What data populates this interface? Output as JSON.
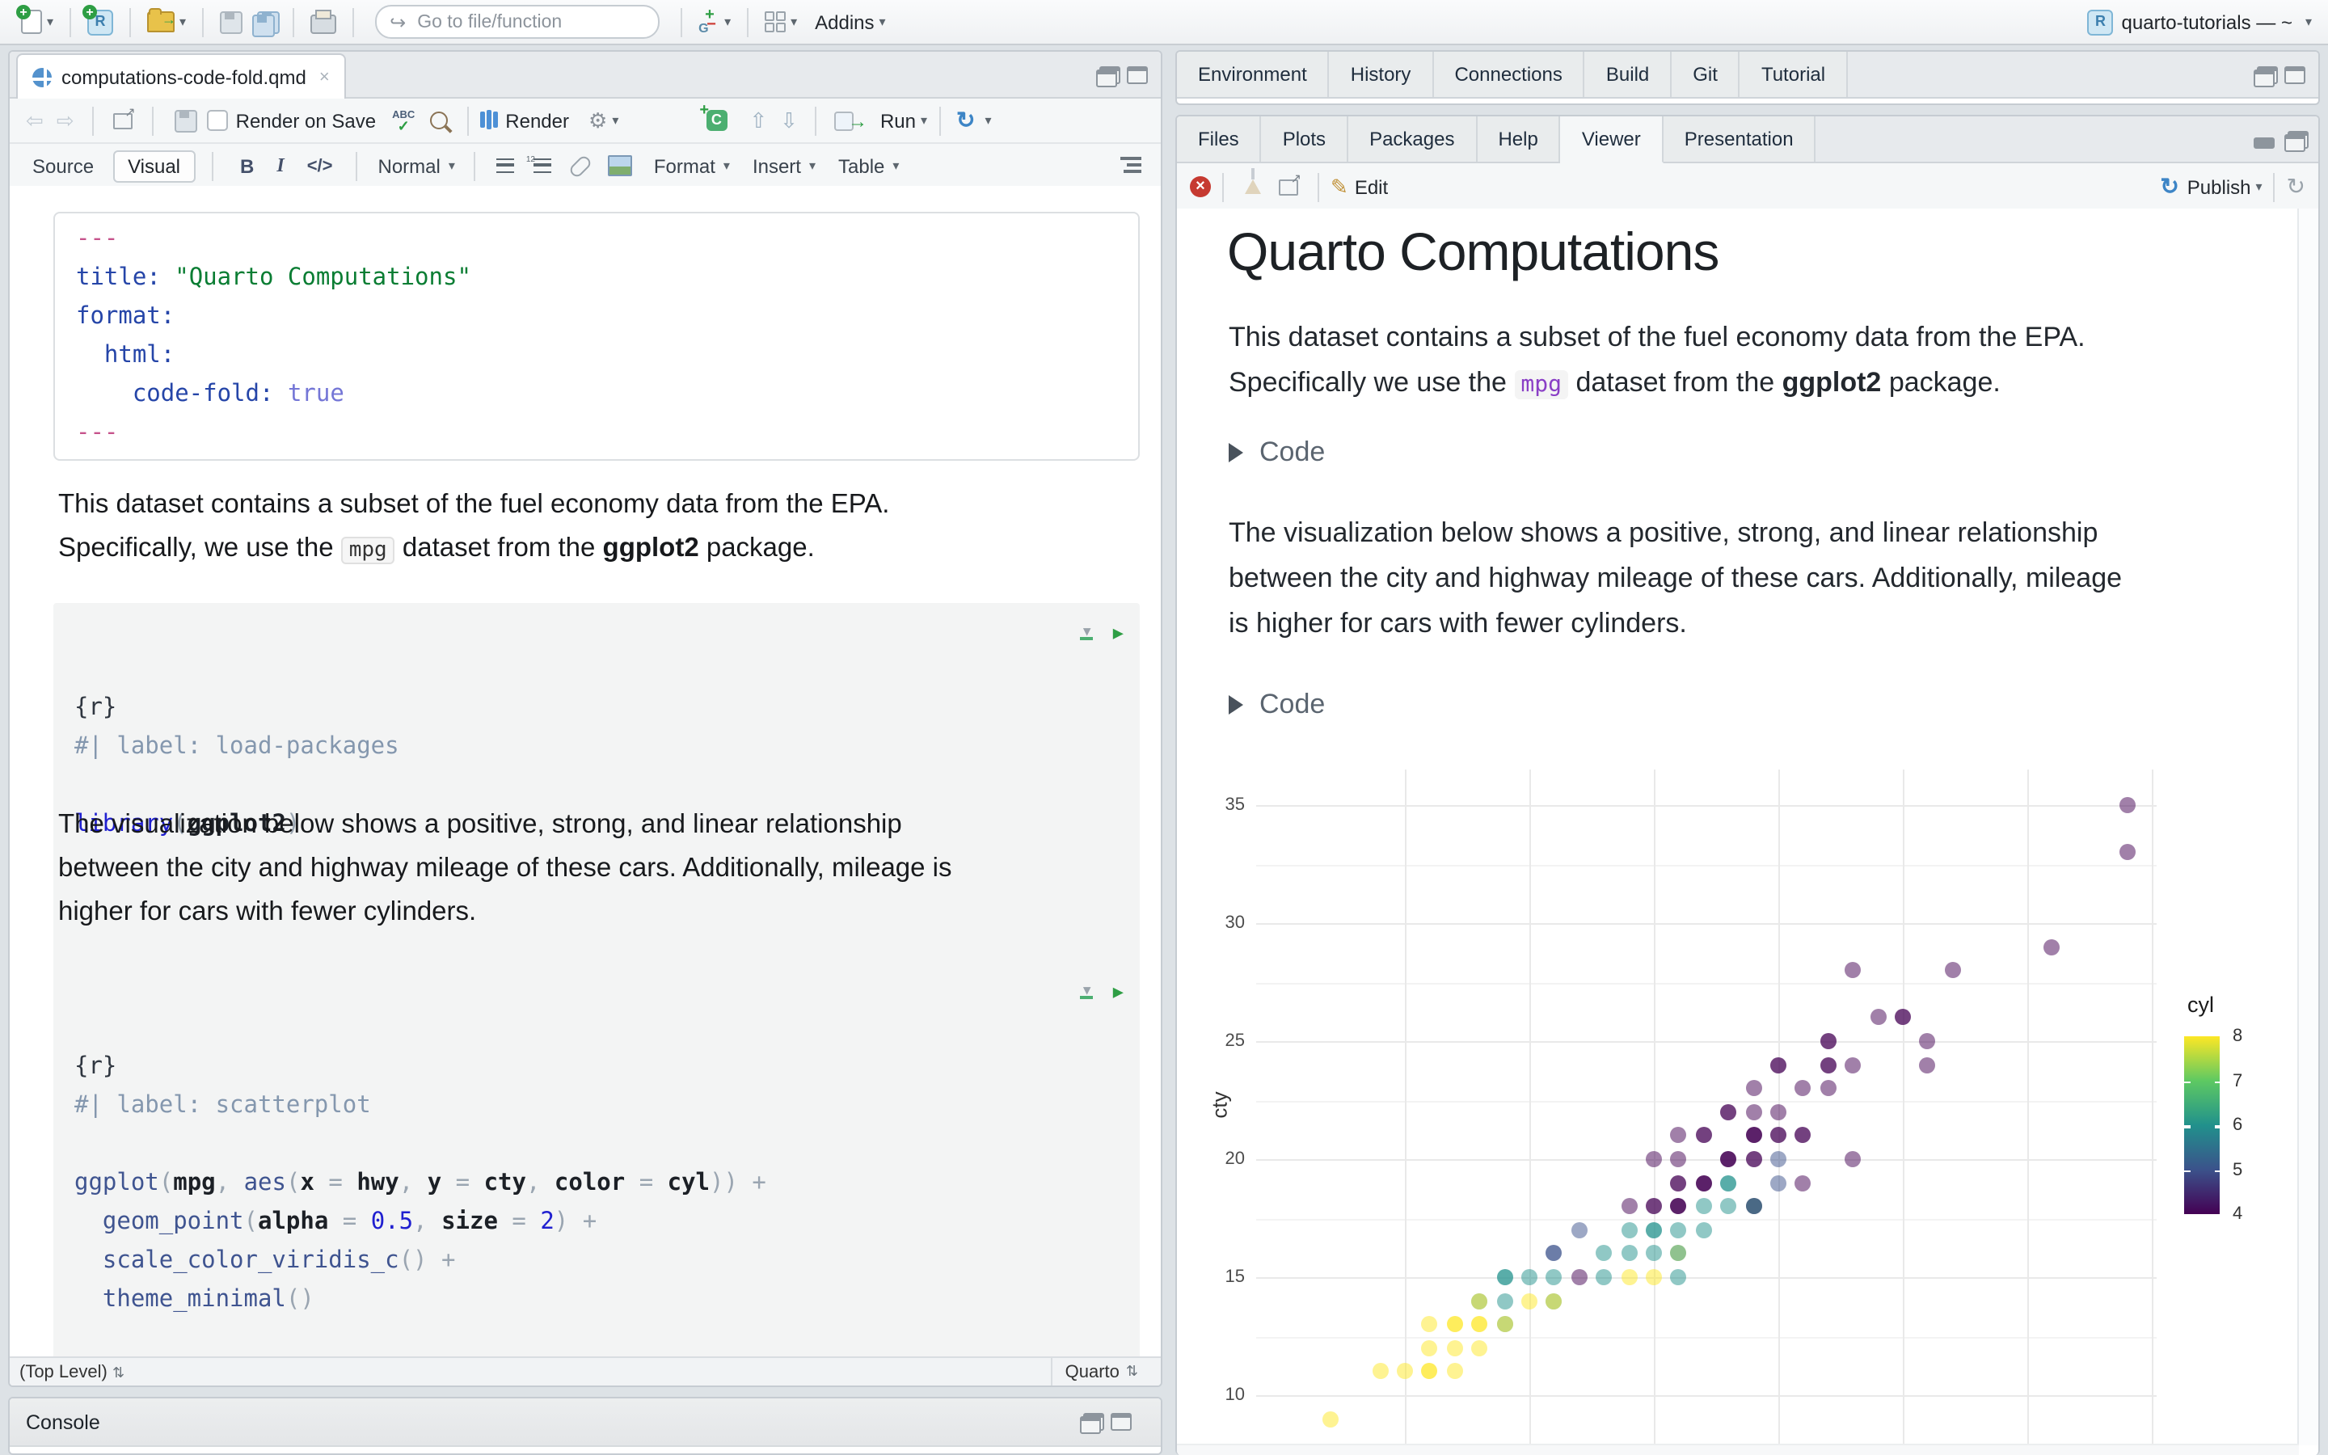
{
  "window": {
    "project": "quarto-tutorials — ~"
  },
  "main_toolbar": {
    "goto_placeholder": "Go to file/function",
    "addins": "Addins"
  },
  "editor": {
    "tab_title": "computations-code-fold.qmd",
    "toolbar": {
      "render_on_save": "Render on Save",
      "render": "Render",
      "run": "Run"
    },
    "format_bar": {
      "source": "Source",
      "visual": "Visual",
      "paragraph_style": "Normal",
      "format": "Format",
      "insert": "Insert",
      "table": "Table"
    },
    "yaml_lines": [
      [
        [
          "---",
          "pink"
        ]
      ],
      [
        [
          "title",
          "key"
        ],
        [
          ": ",
          "key"
        ],
        [
          "\"Quarto Computations\"",
          "str"
        ]
      ],
      [
        [
          "format",
          "key"
        ],
        [
          ":",
          "key"
        ]
      ],
      [
        [
          "  html",
          "key"
        ],
        [
          ":",
          "key"
        ]
      ],
      [
        [
          "    code-fold",
          "key"
        ],
        [
          ": ",
          "key"
        ],
        [
          "true",
          "bool"
        ]
      ],
      [
        [
          "---",
          "pink"
        ]
      ]
    ],
    "para1_lines": [
      [
        [
          "This dataset contains a subset of the fuel economy data from the EPA.",
          ""
        ]
      ],
      [
        [
          "Specifically, we use the ",
          ""
        ],
        [
          "mpg",
          "chip"
        ],
        [
          " dataset from the ",
          ""
        ],
        [
          "ggplot2",
          "b"
        ],
        [
          " package.",
          ""
        ]
      ]
    ],
    "chunk1_lines": [
      [
        [
          "{r}",
          "hdr"
        ]
      ],
      [
        [
          "#| label: load-packages",
          "cmt"
        ]
      ],
      [
        [
          " ",
          ""
        ]
      ],
      [
        [
          "library",
          "blue"
        ],
        [
          "(",
          "par"
        ],
        [
          "ggplot2",
          "arg"
        ],
        [
          ")",
          "par"
        ]
      ]
    ],
    "para2_lines": [
      [
        [
          "The visualization below shows a positive, strong, and linear relationship",
          ""
        ]
      ],
      [
        [
          "between the city and highway mileage of these cars. Additionally, mileage is",
          ""
        ]
      ],
      [
        [
          "higher for cars with fewer cylinders.",
          ""
        ]
      ]
    ],
    "chunk2_lines": [
      [
        [
          "{r}",
          "hdr"
        ]
      ],
      [
        [
          "#| label: scatterplot",
          "cmt"
        ]
      ],
      [
        [
          " ",
          ""
        ]
      ],
      [
        [
          "ggplot",
          "fn"
        ],
        [
          "(",
          "par"
        ],
        [
          "mpg",
          "arg"
        ],
        [
          ", ",
          "par"
        ],
        [
          "aes",
          "fn"
        ],
        [
          "(",
          "par"
        ],
        [
          "x ",
          "arg"
        ],
        [
          "= ",
          "op"
        ],
        [
          "hwy",
          "arg"
        ],
        [
          ", ",
          "par"
        ],
        [
          "y ",
          "arg"
        ],
        [
          "= ",
          "op"
        ],
        [
          "cty",
          "arg"
        ],
        [
          ", ",
          "par"
        ],
        [
          "color ",
          "arg"
        ],
        [
          "= ",
          "op"
        ],
        [
          "cyl",
          "arg"
        ],
        [
          "))",
          "par"
        ],
        [
          " +",
          "op"
        ]
      ],
      [
        [
          "  geom_point",
          "fn"
        ],
        [
          "(",
          "par"
        ],
        [
          "alpha ",
          "arg"
        ],
        [
          "= ",
          "op"
        ],
        [
          "0.5",
          "num"
        ],
        [
          ", ",
          "par"
        ],
        [
          "size ",
          "arg"
        ],
        [
          "= ",
          "op"
        ],
        [
          "2",
          "num"
        ],
        [
          ")",
          "par"
        ],
        [
          " +",
          "op"
        ]
      ],
      [
        [
          "  scale_color_viridis_c",
          "fn"
        ],
        [
          "()",
          "par"
        ],
        [
          " +",
          "op"
        ]
      ],
      [
        [
          "  theme_minimal",
          "fn"
        ],
        [
          "()",
          "par"
        ]
      ]
    ],
    "jump_left": "(Top Level)",
    "jump_right": "Quarto"
  },
  "console": {
    "title": "Console"
  },
  "right_top_tabs": [
    "Environment",
    "History",
    "Connections",
    "Build",
    "Git",
    "Tutorial"
  ],
  "viewer_tabs": [
    "Files",
    "Plots",
    "Packages",
    "Help",
    "Viewer",
    "Presentation"
  ],
  "viewer_active_tab": "Viewer",
  "viewer_toolbar": {
    "edit": "Edit",
    "publish": "Publish"
  },
  "viewer_doc": {
    "title": "Quarto Computations",
    "para1_lines": [
      [
        [
          "This dataset contains a subset of the fuel economy data from the EPA.",
          ""
        ]
      ],
      [
        [
          "Specifically we use the ",
          ""
        ],
        [
          "mpg",
          "vchip"
        ],
        [
          " dataset from the ",
          ""
        ],
        [
          "ggplot2",
          "b"
        ],
        [
          " package.",
          ""
        ]
      ]
    ],
    "code_fold1": "Code",
    "para2_lines": [
      [
        [
          "The visualization below shows a positive, strong, and linear relationship",
          ""
        ]
      ],
      [
        [
          "between the city and highway mileage of these cars. Additionally, mileage",
          ""
        ]
      ],
      [
        [
          "is higher for cars with fewer cylinders.",
          ""
        ]
      ]
    ],
    "code_fold2": "Code"
  },
  "chart_data": {
    "type": "scatter",
    "x_var": "hwy",
    "y_var": "cty",
    "color_var": "cyl",
    "ylabel": "cty",
    "y_ticks": [
      10,
      15,
      20,
      25,
      30,
      35
    ],
    "y_minor": [
      12.5,
      17.5,
      22.5,
      27.5,
      32.5
    ],
    "x_gridlines": [
      15,
      20,
      25,
      30,
      35,
      40,
      45
    ],
    "point_alpha": 0.5,
    "grid": true,
    "legend": {
      "title": "cyl",
      "ticks": [
        8,
        7,
        6,
        5,
        4
      ],
      "position": "right",
      "colors": {
        "4": "#440154",
        "5": "#3b528b",
        "6": "#21918c",
        "8": "#fde725"
      },
      "gradient": [
        "#fde725",
        "#5ec962",
        "#21918c",
        "#3b528b",
        "#440154"
      ]
    },
    "points": [
      [
        44,
        35,
        4,
        1
      ],
      [
        44,
        33,
        4,
        1
      ],
      [
        41,
        29,
        4,
        1
      ],
      [
        37,
        28,
        4,
        1
      ],
      [
        33,
        28,
        4,
        1
      ],
      [
        35,
        26,
        4,
        2
      ],
      [
        34,
        26,
        4,
        1
      ],
      [
        36,
        25,
        4,
        1
      ],
      [
        32,
        25,
        4,
        2
      ],
      [
        36,
        24,
        4,
        1
      ],
      [
        33,
        24,
        4,
        1
      ],
      [
        32,
        24,
        4,
        2
      ],
      [
        30,
        24,
        4,
        2
      ],
      [
        32,
        23,
        4,
        1
      ],
      [
        31,
        23,
        4,
        1
      ],
      [
        29,
        23,
        4,
        1
      ],
      [
        30,
        22,
        4,
        1
      ],
      [
        29,
        22,
        4,
        1
      ],
      [
        28,
        22,
        4,
        2
      ],
      [
        31,
        21,
        4,
        2
      ],
      [
        30,
        21,
        4,
        2
      ],
      [
        29,
        21,
        4,
        3
      ],
      [
        27,
        21,
        4,
        2
      ],
      [
        26,
        21,
        4,
        1
      ],
      [
        33,
        20,
        4,
        1
      ],
      [
        30,
        20,
        5,
        1
      ],
      [
        29,
        20,
        4,
        2
      ],
      [
        28,
        20,
        4,
        3
      ],
      [
        26,
        20,
        4,
        1
      ],
      [
        25,
        20,
        4,
        1
      ],
      [
        31,
        19,
        4,
        1
      ],
      [
        30,
        19,
        5,
        1
      ],
      [
        28,
        19,
        6,
        2
      ],
      [
        27,
        19,
        4,
        3
      ],
      [
        26,
        19,
        4,
        2
      ],
      [
        29,
        18,
        4,
        2
      ],
      [
        29,
        18,
        6,
        1
      ],
      [
        28,
        18,
        6,
        1
      ],
      [
        27,
        18,
        6,
        1
      ],
      [
        26,
        18,
        4,
        3
      ],
      [
        25,
        18,
        4,
        2
      ],
      [
        24,
        18,
        4,
        1
      ],
      [
        27,
        17,
        6,
        1
      ],
      [
        26,
        17,
        6,
        1
      ],
      [
        25,
        17,
        6,
        2
      ],
      [
        24,
        17,
        6,
        1
      ],
      [
        22,
        17,
        5,
        1
      ],
      [
        26,
        16,
        8,
        1
      ],
      [
        26,
        16,
        6,
        1
      ],
      [
        25,
        16,
        6,
        1
      ],
      [
        24,
        16,
        6,
        1
      ],
      [
        23,
        16,
        6,
        1
      ],
      [
        21,
        16,
        5,
        2
      ],
      [
        26,
        15,
        6,
        1
      ],
      [
        25,
        15,
        8,
        1
      ],
      [
        24,
        15,
        8,
        1
      ],
      [
        23,
        15,
        6,
        1
      ],
      [
        22,
        15,
        4,
        1
      ],
      [
        21,
        15,
        6,
        1
      ],
      [
        20,
        15,
        6,
        1
      ],
      [
        19,
        15,
        6,
        2
      ],
      [
        21,
        14,
        6,
        1
      ],
      [
        21,
        14,
        8,
        1
      ],
      [
        20,
        14,
        8,
        1
      ],
      [
        19,
        14,
        6,
        1
      ],
      [
        18,
        14,
        6,
        1
      ],
      [
        18,
        14,
        8,
        1
      ],
      [
        19,
        13,
        6,
        1
      ],
      [
        19,
        13,
        8,
        1
      ],
      [
        18,
        13,
        8,
        2
      ],
      [
        17,
        13,
        8,
        2
      ],
      [
        16,
        13,
        8,
        1
      ],
      [
        18,
        12,
        8,
        1
      ],
      [
        17,
        12,
        8,
        1
      ],
      [
        16,
        12,
        8,
        1
      ],
      [
        17,
        11,
        8,
        1
      ],
      [
        16,
        11,
        8,
        2
      ],
      [
        15,
        11,
        8,
        1
      ],
      [
        14,
        11,
        8,
        1
      ],
      [
        12,
        9,
        8,
        1
      ]
    ]
  }
}
